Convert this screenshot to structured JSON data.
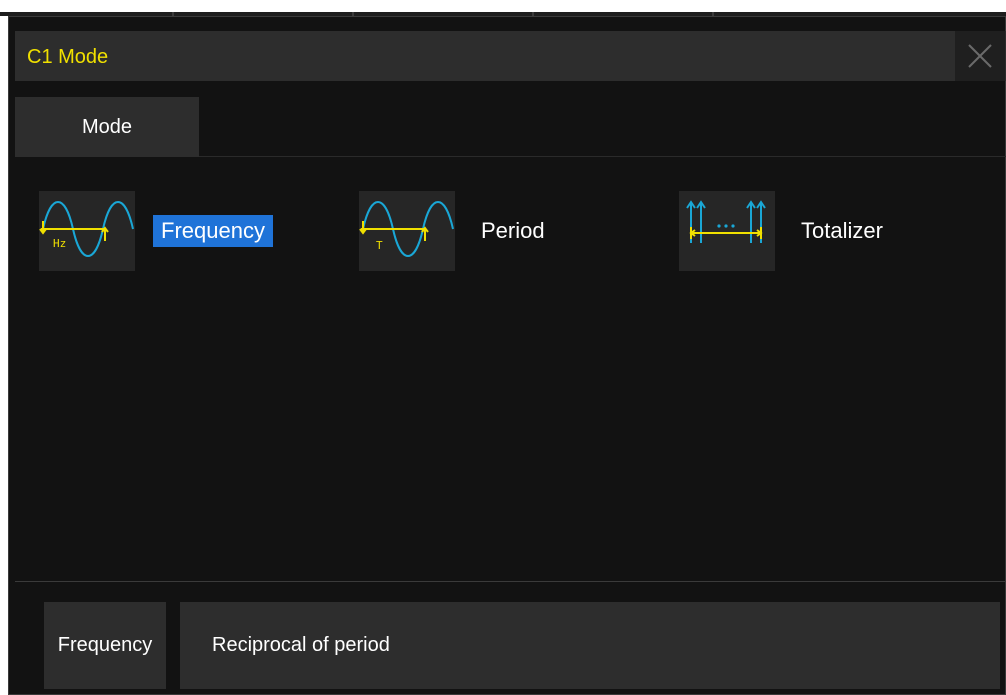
{
  "dialog": {
    "title": "C1 Mode",
    "close_icon": "close-icon"
  },
  "tabs": [
    {
      "label": "Mode",
      "active": true
    }
  ],
  "options": [
    {
      "id": "frequency",
      "label": "Frequency",
      "icon": "frequency-icon",
      "icon_text": "Hz",
      "selected": true
    },
    {
      "id": "period",
      "label": "Period",
      "icon": "period-icon",
      "icon_text": "T",
      "selected": false
    },
    {
      "id": "totalizer",
      "label": "Totalizer",
      "icon": "totalizer-icon",
      "selected": false
    }
  ],
  "help": {
    "name": "Frequency",
    "description": "Reciprocal of period"
  },
  "colors": {
    "title": "#f0e000",
    "selection": "#1f73d8",
    "wave": "#1aa7d6",
    "marker": "#f0e000"
  }
}
